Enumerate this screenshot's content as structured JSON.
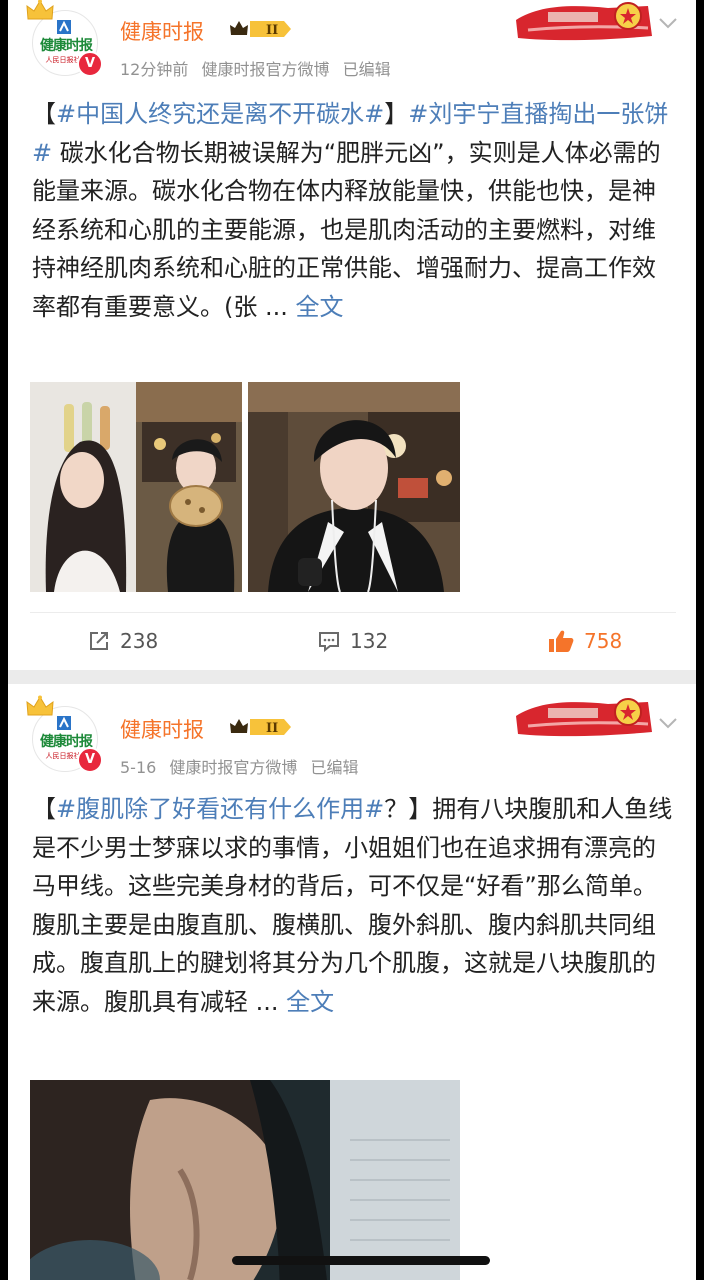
{
  "posts": [
    {
      "author": "健康时报",
      "avatar_text": "健康时报",
      "avatar_sub": "人民日报社",
      "time": "12分钟前",
      "source": "健康时报官方微博",
      "edited": "已编辑",
      "badge_level": "II",
      "text_open": "【",
      "tag1": "#中国人终究还是离不开碳水#",
      "text_mid": "】",
      "tag2": "#刘宇宁直播掏出一张饼#",
      "body": " 碳水化合物长期被误解为“肥胖元凶”，实则是人体必需的能量来源。碳水化合物在体内释放能量快，供能也快，是神经系统和心肌的主要能源，也是肌肉活动的主要燃料，对维持神经肌肉系统和心脏的正常供能、增强耐力、提高工作效率都有重要意义。(张 ... ",
      "full_text": "全文",
      "repost_count": "238",
      "comment_count": "132",
      "like_count": "758"
    },
    {
      "author": "健康时报",
      "avatar_text": "健康时报",
      "avatar_sub": "人民日报社",
      "time": "5-16",
      "source": "健康时报官方微博",
      "edited": "已编辑",
      "badge_level": "II",
      "text_open": "【",
      "tag1": "#腹肌除了好看还有什么作用#",
      "text_mid": "？】",
      "body": "拥有八块腹肌和人鱼线是不少男士梦寐以求的事情，小姐姐们也在追求拥有漂亮的马甲线。这些完美身材的背后，可不仅是“好看”那么简单。腹肌主要是由腹直肌、腹横肌、腹外斜肌、腹内斜肌共同组成。腹直肌上的腱划将其分为几个肌腹，这就是八块腹肌的来源。腹肌具有减轻 ... ",
      "full_text": "全文"
    }
  ],
  "colors": {
    "accent_orange": "#f5742a",
    "link_blue": "#4d7eb8",
    "meta_gray": "#929292",
    "verified_red": "#e8283d"
  },
  "icons": [
    "crown-icon",
    "verified-icon",
    "member-badge-icon",
    "chevron-down-icon",
    "repost-icon",
    "comment-icon",
    "like-icon"
  ]
}
